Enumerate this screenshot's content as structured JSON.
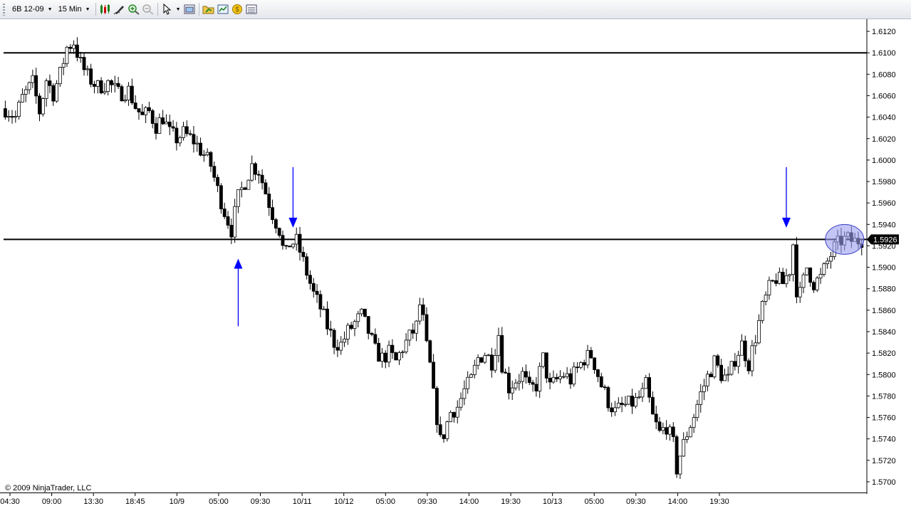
{
  "toolbar": {
    "instrument": "6B 12-09",
    "interval": "15 Min",
    "icons": [
      "chart-style-icon",
      "drawing-tool-icon",
      "zoom-in-icon",
      "zoom-out-icon",
      "pointer-icon",
      "properties-icon",
      "open-chart-icon",
      "data-box-icon",
      "currency-icon",
      "indicators-icon"
    ]
  },
  "colors": {
    "candle_up_fill": "#ffffff",
    "candle_down_fill": "#000000",
    "annotation_arrow": "#0000ff",
    "highlight_ellipse": "#9b9ff0",
    "price_marker_bg": "#000000"
  },
  "copyright": "© 2009 NinjaTrader, LLC",
  "chart_data": {
    "type": "candlestick",
    "title": "",
    "ylim": [
      1.569,
      1.613
    ],
    "y_ticks": [
      "1.6120",
      "1.6100",
      "1.6080",
      "1.6060",
      "1.6040",
      "1.6020",
      "1.6000",
      "1.5980",
      "1.5960",
      "1.5940",
      "1.5926",
      "1.5920",
      "1.5900",
      "1.5880",
      "1.5860",
      "1.5840",
      "1.5820",
      "1.5800",
      "1.5780",
      "1.5760",
      "1.5740",
      "1.5720",
      "1.5700"
    ],
    "x_ticks": [
      "04:30",
      "09:00",
      "13:30",
      "18:45",
      "10/9",
      "05:00",
      "09:30",
      "10/11",
      "10/12",
      "05:00",
      "09:30",
      "14:00",
      "19:30",
      "10/13",
      "05:00",
      "09:30",
      "14:00",
      "19:30"
    ],
    "horizontal_lines": [
      1.61,
      1.5926
    ],
    "last_price": "1.5926",
    "close_path": [
      [
        0,
        1.6048
      ],
      [
        3,
        1.604
      ],
      [
        5,
        1.6058
      ],
      [
        8,
        1.6072
      ],
      [
        10,
        1.6045
      ],
      [
        12,
        1.6075
      ],
      [
        14,
        1.6062
      ],
      [
        16,
        1.608
      ],
      [
        18,
        1.6105
      ],
      [
        20,
        1.611
      ],
      [
        22,
        1.609
      ],
      [
        24,
        1.6078
      ],
      [
        27,
        1.6068
      ],
      [
        30,
        1.6072
      ],
      [
        33,
        1.6062
      ],
      [
        36,
        1.6065
      ],
      [
        38,
        1.605
      ],
      [
        40,
        1.604
      ],
      [
        42,
        1.6045
      ],
      [
        44,
        1.6032
      ],
      [
        46,
        1.604
      ],
      [
        48,
        1.6025
      ],
      [
        50,
        1.602
      ],
      [
        52,
        1.6025
      ],
      [
        55,
        1.6018
      ],
      [
        58,
        1.6005
      ],
      [
        60,
        1.5995
      ],
      [
        62,
        1.5972
      ],
      [
        64,
        1.5952
      ],
      [
        66,
        1.5935
      ],
      [
        68,
        1.5965
      ],
      [
        70,
        1.598
      ],
      [
        72,
        1.5995
      ],
      [
        74,
        1.599
      ],
      [
        76,
        1.597
      ],
      [
        78,
        1.595
      ],
      [
        80,
        1.5935
      ],
      [
        81,
        1.5918
      ],
      [
        82,
        1.5912
      ],
      [
        83,
        1.5922
      ],
      [
        85,
        1.5924
      ],
      [
        86,
        1.5915
      ],
      [
        88,
        1.5895
      ],
      [
        90,
        1.5875
      ],
      [
        92,
        1.5862
      ],
      [
        94,
        1.5845
      ],
      [
        96,
        1.583
      ],
      [
        98,
        1.5828
      ],
      [
        100,
        1.584
      ],
      [
        102,
        1.5848
      ],
      [
        104,
        1.5855
      ],
      [
        106,
        1.584
      ],
      [
        108,
        1.5822
      ],
      [
        110,
        1.5815
      ],
      [
        112,
        1.582
      ],
      [
        114,
        1.5812
      ],
      [
        116,
        1.5825
      ],
      [
        118,
        1.5835
      ],
      [
        120,
        1.5845
      ],
      [
        121,
        1.5865
      ],
      [
        122,
        1.585
      ],
      [
        123,
        1.5825
      ],
      [
        124,
        1.5808
      ],
      [
        125,
        1.578
      ],
      [
        126,
        1.576
      ],
      [
        127,
        1.5738
      ],
      [
        128,
        1.5745
      ],
      [
        130,
        1.5765
      ],
      [
        132,
        1.577
      ],
      [
        134,
        1.5785
      ],
      [
        136,
        1.5795
      ],
      [
        138,
        1.5815
      ],
      [
        140,
        1.582
      ],
      [
        142,
        1.5812
      ],
      [
        144,
        1.5838
      ],
      [
        145,
        1.581
      ],
      [
        147,
        1.5788
      ],
      [
        149,
        1.5795
      ],
      [
        151,
        1.58
      ],
      [
        153,
        1.5785
      ],
      [
        155,
        1.579
      ],
      [
        157,
        1.5815
      ],
      [
        159,
        1.5788
      ],
      [
        161,
        1.5795
      ],
      [
        163,
        1.58
      ],
      [
        165,
        1.5795
      ],
      [
        167,
        1.5805
      ],
      [
        169,
        1.5815
      ],
      [
        171,
        1.5818
      ],
      [
        172,
        1.581
      ],
      [
        174,
        1.579
      ],
      [
        176,
        1.5775
      ],
      [
        178,
        1.5765
      ],
      [
        180,
        1.577
      ],
      [
        182,
        1.5772
      ],
      [
        184,
        1.5775
      ],
      [
        186,
        1.5782
      ],
      [
        187,
        1.579
      ],
      [
        189,
        1.576
      ],
      [
        191,
        1.5745
      ],
      [
        193,
        1.5752
      ],
      [
        195,
        1.5735
      ],
      [
        196,
        1.5712
      ],
      [
        197,
        1.5725
      ],
      [
        199,
        1.5745
      ],
      [
        201,
        1.5762
      ],
      [
        203,
        1.5782
      ],
      [
        205,
        1.5798
      ],
      [
        207,
        1.5812
      ],
      [
        209,
        1.58
      ],
      [
        211,
        1.5795
      ],
      [
        213,
        1.5815
      ],
      [
        215,
        1.5828
      ],
      [
        217,
        1.581
      ],
      [
        219,
        1.5835
      ],
      [
        221,
        1.5862
      ],
      [
        223,
        1.588
      ],
      [
        225,
        1.589
      ],
      [
        227,
        1.5885
      ],
      [
        229,
        1.5898
      ],
      [
        230,
        1.5922
      ],
      [
        231,
        1.588
      ],
      [
        232,
        1.5875
      ],
      [
        234,
        1.59
      ],
      [
        236,
        1.5885
      ],
      [
        238,
        1.589
      ],
      [
        240,
        1.5905
      ],
      [
        242,
        1.5918
      ],
      [
        244,
        1.5925
      ],
      [
        246,
        1.5926
      ],
      [
        248,
        1.5924
      ],
      [
        250,
        1.5926
      ]
    ],
    "annotations": [
      {
        "type": "arrow",
        "direction": "down",
        "at_bar": 84,
        "tip_price": 1.5937
      },
      {
        "type": "arrow",
        "direction": "up",
        "at_bar": 68,
        "tip_price": 1.5908
      },
      {
        "type": "arrow",
        "direction": "down",
        "at_bar": 228,
        "tip_price": 1.5937
      },
      {
        "type": "ellipse",
        "center_bar": 245,
        "center_price": 1.5926
      }
    ]
  }
}
